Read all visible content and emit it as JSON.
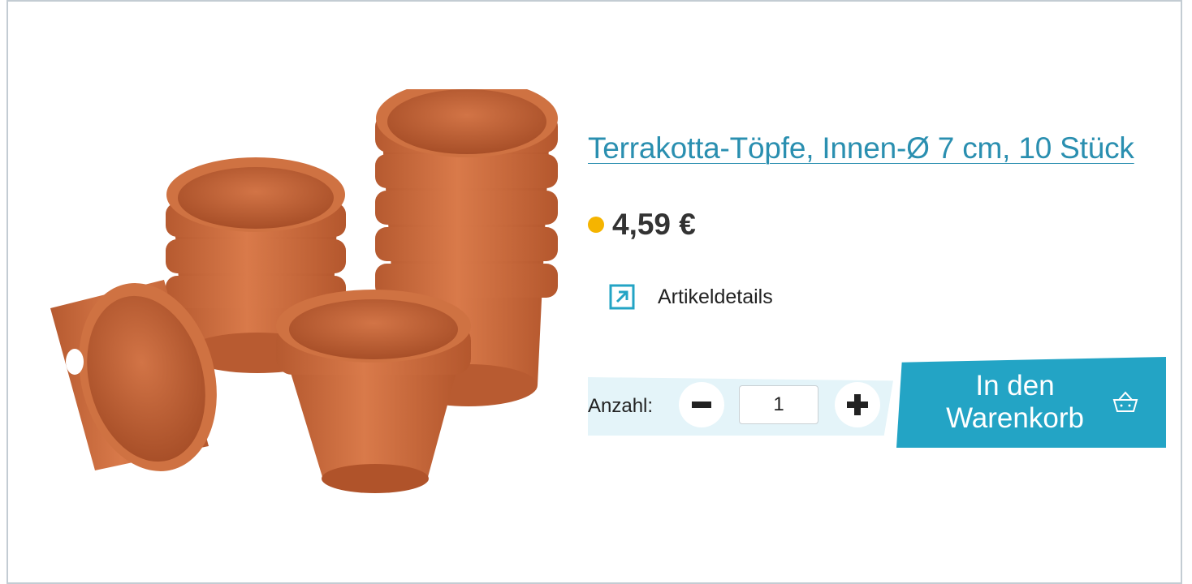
{
  "product": {
    "title": "Terrakotta-Töpfe, Innen-Ø 7 cm, 10 Stück",
    "price": "4,59 €",
    "availability_color": "#f5b400",
    "details_label": "Artikeldetails",
    "image_description_icon": "terracotta-pots-image"
  },
  "quantity": {
    "label": "Anzahl:",
    "value": "1",
    "decrement_icon": "minus-icon",
    "increment_icon": "plus-icon"
  },
  "cart": {
    "button_line1": "In den",
    "button_line2": "Warenkorb",
    "icon": "basket-icon",
    "color": "#23a4c5"
  },
  "colors": {
    "link": "#2a8fb0",
    "quantity_bg": "#e4f4f9",
    "terracotta": "#c8693c"
  }
}
